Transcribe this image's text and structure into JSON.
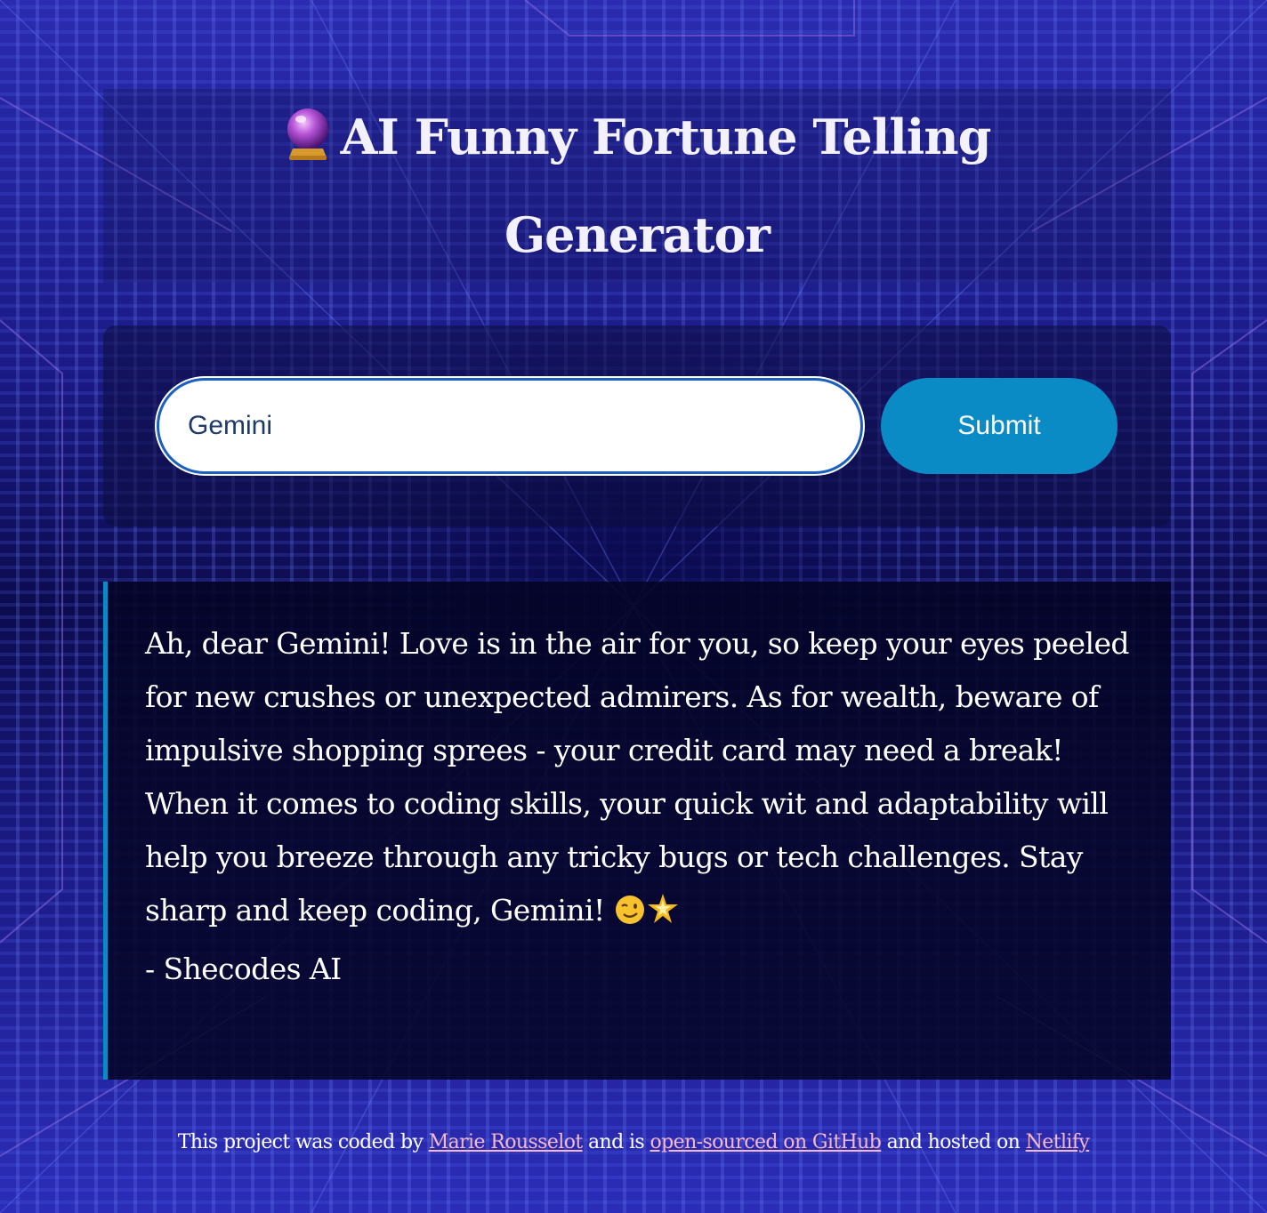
{
  "header": {
    "orb_icon": "crystal-ball-icon",
    "title": "AI Funny Fortune Telling Generator"
  },
  "form": {
    "input_value": "Gemini",
    "submit_label": "Submit"
  },
  "fortune": {
    "text": "Ah, dear Gemini! Love is in the air for you, so keep your eyes peeled for new crushes or unexpected admirers. As for wealth, beware of impulsive shopping sprees - your credit card may need a break! When it comes to coding skills, your quick wit and adaptability will help you breeze through any tricky bugs or tech challenges. Stay sharp and keep coding, Gemini!",
    "emoji_icons": [
      "winking-face-icon",
      "glowing-star-icon"
    ],
    "signature": "- Shecodes AI"
  },
  "footer": {
    "text_1": "This project was coded by",
    "author_link": "Marie Rousselot",
    "text_2": "and is",
    "github_link": "open-sourced on GitHub",
    "text_3": "and hosted on",
    "netlify_link": "Netlify"
  },
  "colors": {
    "accent": "#0a8bc6",
    "link": "#f8b8c9",
    "background": "#15146a"
  }
}
